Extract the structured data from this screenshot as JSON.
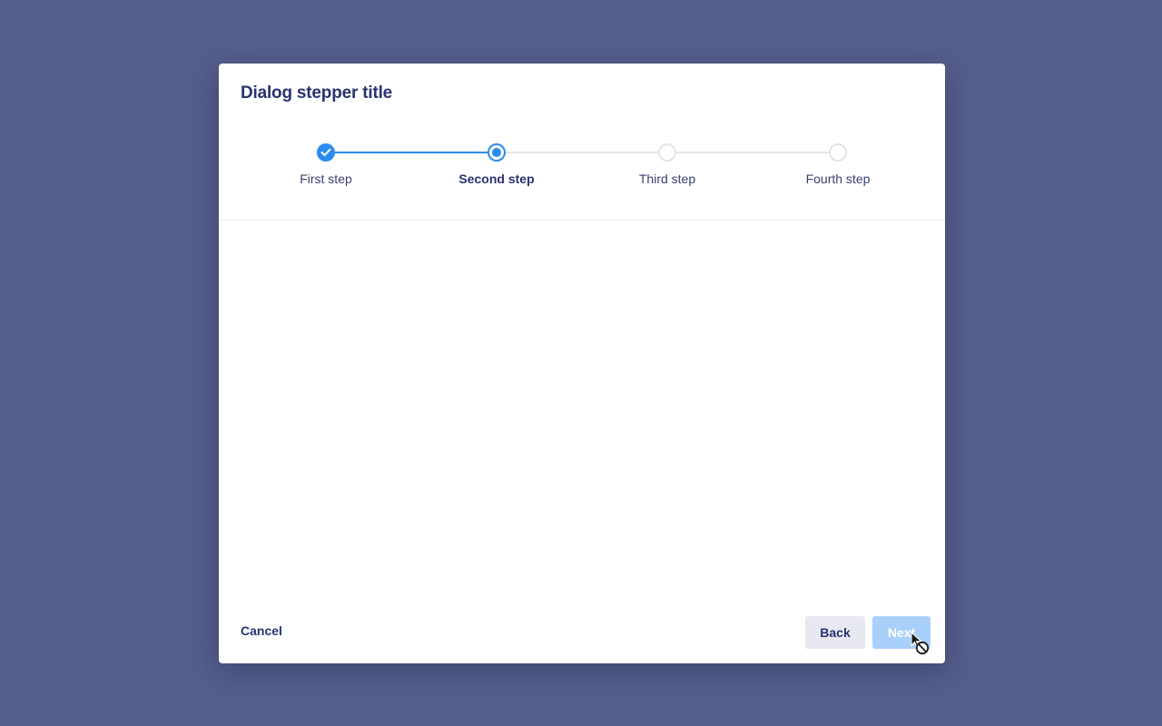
{
  "dialog": {
    "title": "Dialog stepper title"
  },
  "stepper": {
    "steps": [
      {
        "label": "First step",
        "state": "completed"
      },
      {
        "label": "Second step",
        "state": "current"
      },
      {
        "label": "Third step",
        "state": "upcoming"
      },
      {
        "label": "Fourth step",
        "state": "upcoming"
      }
    ]
  },
  "footer": {
    "cancel_label": "Cancel",
    "back_label": "Back",
    "next_label": "Next",
    "next_disabled": true
  },
  "colors": {
    "backdrop": "#555e8c",
    "accent": "#2b8cf0",
    "accent_disabled": "#a9d0fb",
    "text_primary": "#2a3370",
    "track": "#e3e4ea"
  },
  "icons": {
    "completed_step": "check-icon",
    "cursor": "not-allowed-cursor-icon"
  }
}
